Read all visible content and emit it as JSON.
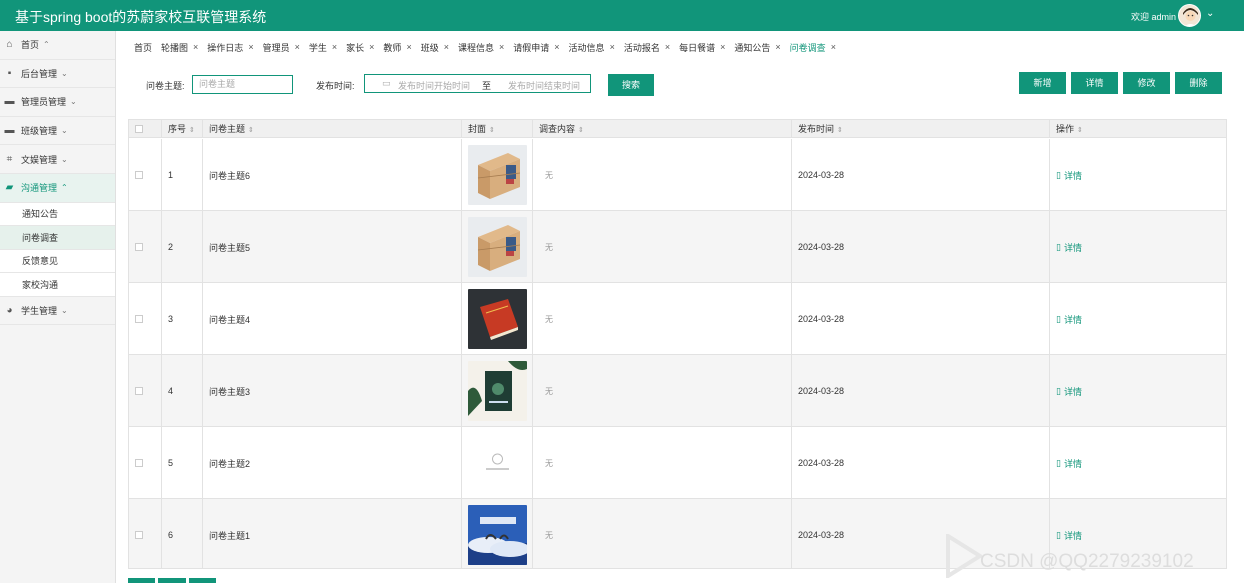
{
  "app": {
    "title": "基于spring boot的苏蔚家校互联管理系统",
    "welcome": "欢迎 admin"
  },
  "sidebar": {
    "items": [
      {
        "label": "首页",
        "icon": "home-icon",
        "caret": "^"
      },
      {
        "label": "后台管理",
        "icon": "save-icon",
        "caret": "v"
      },
      {
        "label": "管理员管理",
        "icon": "grid-icon",
        "caret": "v"
      },
      {
        "label": "班级管理",
        "icon": "card-icon",
        "caret": "v"
      },
      {
        "label": "文娱管理",
        "icon": "crop-icon",
        "caret": "v"
      },
      {
        "label": "沟通管理",
        "icon": "chat-icon",
        "caret": "^"
      },
      {
        "label": "学生管理",
        "icon": "gauge-icon",
        "caret": "v"
      }
    ],
    "sub": [
      {
        "label": "通知公告"
      },
      {
        "label": "问卷调查"
      },
      {
        "label": "反馈意见"
      },
      {
        "label": "家校沟通"
      }
    ]
  },
  "tabs": [
    {
      "label": "首页",
      "closable": false
    },
    {
      "label": "轮播图",
      "closable": true
    },
    {
      "label": "操作日志",
      "closable": true
    },
    {
      "label": "管理员",
      "closable": true
    },
    {
      "label": "学生",
      "closable": true
    },
    {
      "label": "家长",
      "closable": true
    },
    {
      "label": "教师",
      "closable": true
    },
    {
      "label": "班级",
      "closable": true
    },
    {
      "label": "课程信息",
      "closable": true
    },
    {
      "label": "请假申请",
      "closable": true
    },
    {
      "label": "活动信息",
      "closable": true
    },
    {
      "label": "活动报名",
      "closable": true
    },
    {
      "label": "每日餐谱",
      "closable": true
    },
    {
      "label": "通知公告",
      "closable": true
    },
    {
      "label": "问卷调查",
      "closable": true,
      "active": true
    }
  ],
  "search": {
    "topic_label": "问卷主题:",
    "topic_placeholder": "问卷主题",
    "date_label": "发布时间:",
    "date_start_placeholder": "发布时间开始时间",
    "date_sep": "至",
    "date_end_placeholder": "发布时间结束时间",
    "search_button": "搜索"
  },
  "actions": {
    "add": "新增",
    "detail": "详情",
    "edit": "修改",
    "delete": "删除"
  },
  "table": {
    "headers": [
      "序号",
      "问卷主题",
      "封面",
      "调查内容",
      "发布时间",
      "操作"
    ],
    "rows": [
      {
        "index": "1",
        "topic": "问卷主题6",
        "content": "无",
        "date": "2024-03-28",
        "action": "详情",
        "cover": "boxes"
      },
      {
        "index": "2",
        "topic": "问卷主题5",
        "content": "无",
        "date": "2024-03-28",
        "action": "详情",
        "cover": "boxes"
      },
      {
        "index": "3",
        "topic": "问卷主题4",
        "content": "无",
        "date": "2024-03-28",
        "action": "详情",
        "cover": "red-book"
      },
      {
        "index": "4",
        "topic": "问卷主题3",
        "content": "无",
        "date": "2024-03-28",
        "action": "详情",
        "cover": "green-book"
      },
      {
        "index": "5",
        "topic": "问卷主题2",
        "content": "无",
        "date": "2024-03-28",
        "action": "详情",
        "cover": "blank-logo"
      },
      {
        "index": "6",
        "topic": "问卷主题1",
        "content": "无",
        "date": "2024-03-28",
        "action": "详情",
        "cover": "blue-poster"
      }
    ]
  },
  "watermark": "CSDN @QQ2279239102",
  "colors": {
    "accent": "#11957a"
  }
}
